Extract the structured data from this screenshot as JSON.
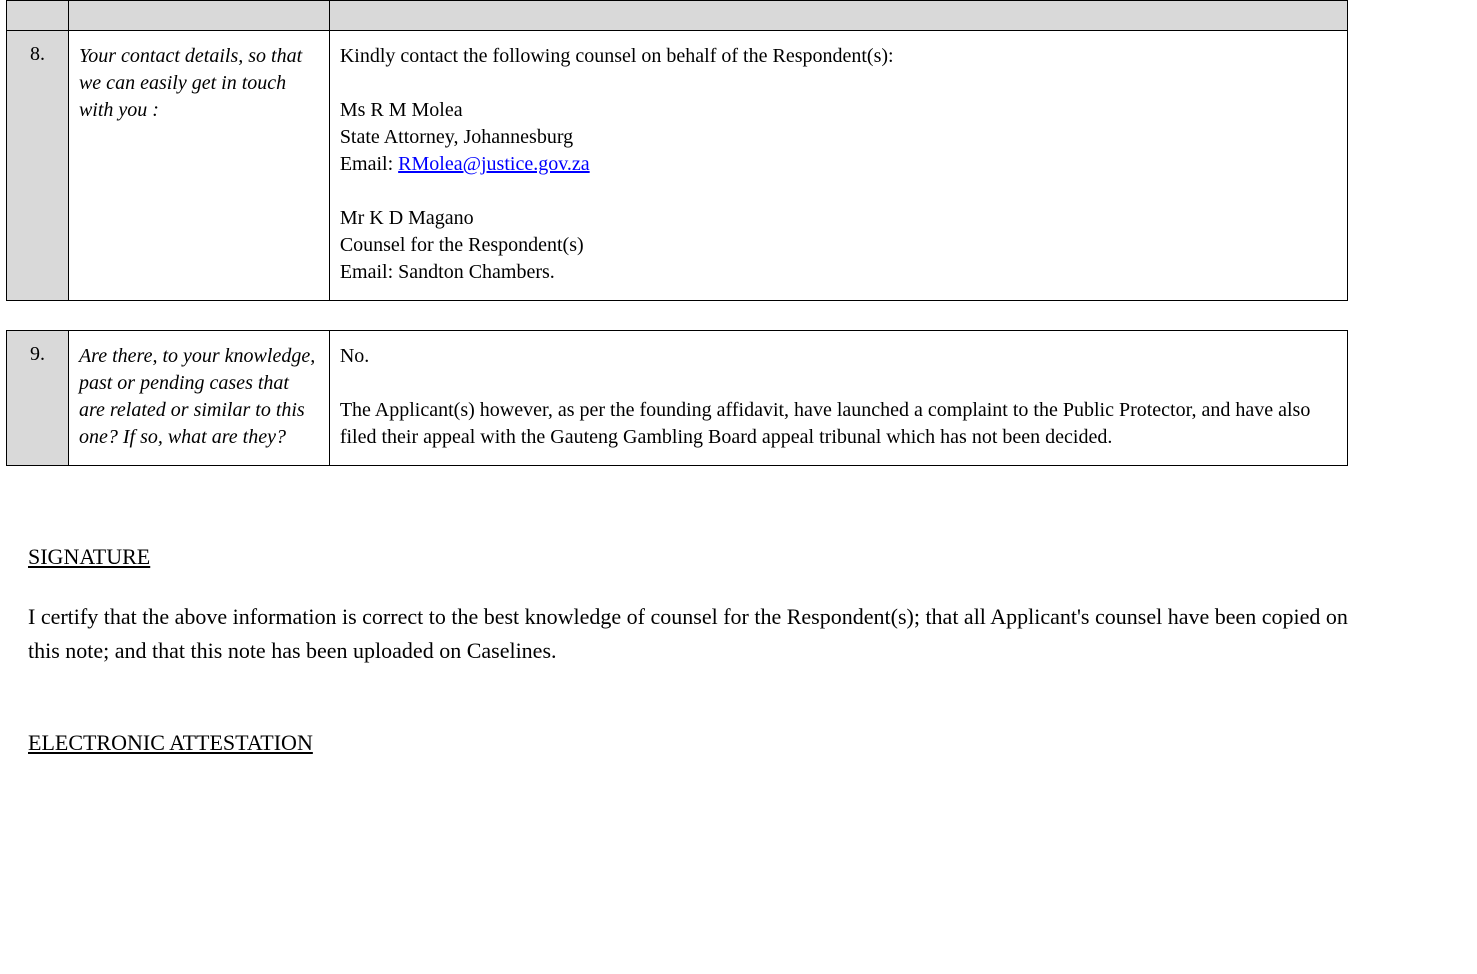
{
  "table": {
    "rows": [
      {
        "num": "8.",
        "label": "Your contact details, so that we can easily get in touch with you :",
        "content_lines": [
          "Kindly contact the following counsel on behalf of the Respondent(s):",
          "",
          "Ms R M Molea",
          "State Attorney, Johannesburg",
          "Email: "
        ],
        "link": "RMolea@justice.gov.za",
        "content_after": [
          "",
          "Mr K D Magano",
          "Counsel for the Respondent(s)",
          "Email: Sandton Chambers."
        ]
      },
      {
        "num": "9.",
        "label": "Are there, to your knowledge, past or pending cases that are related or similar to this one? If so, what are they?",
        "content_lines": [
          "No.",
          "",
          "The Applicant(s) however, as per the founding affidavit, have launched a complaint to the Public Protector, and have also filed their appeal with the Gauteng Gambling Board appeal tribunal which has not been decided."
        ]
      }
    ]
  },
  "signature": {
    "heading": "SIGNATURE",
    "body": "I certify that the above information is correct to the best knowledge of counsel for the Respondent(s); that all Applicant's counsel have been copied on this note; and that this note has been uploaded on Caselines."
  },
  "attestation": {
    "heading": "ELECTRONIC ATTESTATION"
  }
}
